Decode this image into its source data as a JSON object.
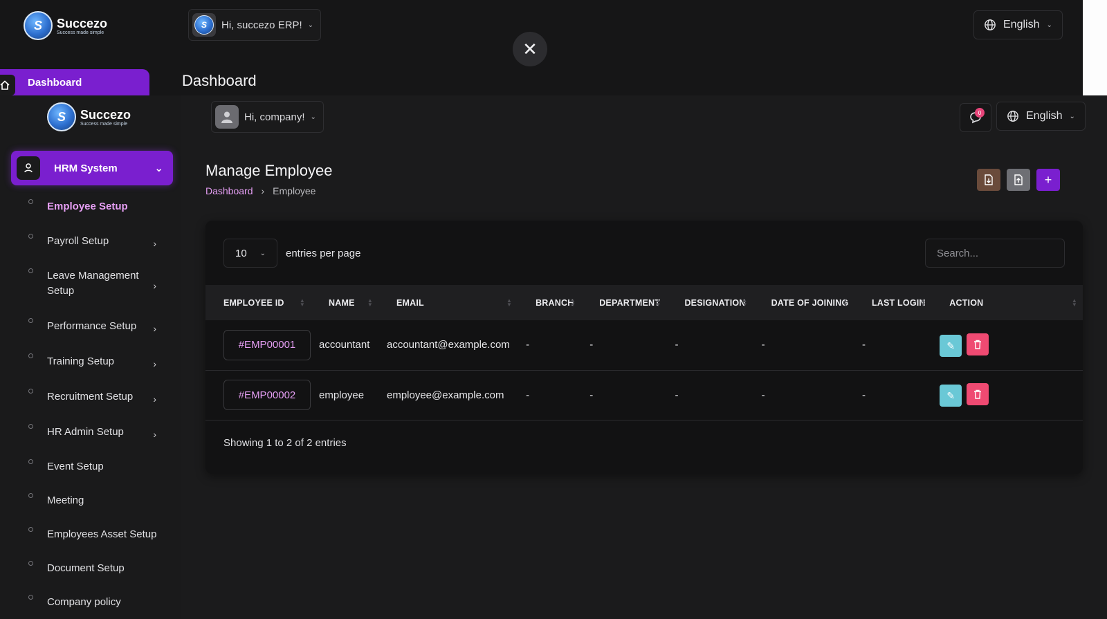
{
  "outer": {
    "brand": "Succezo",
    "tagline": "Success made simple",
    "user_greeting": "Hi, succezo ERP!",
    "language": "English",
    "dashboard_tab": "Dashboard",
    "page_heading": "Dashboard"
  },
  "sidebar": {
    "brand": "Succezo",
    "tagline": "Success made simple",
    "module": "HRM System",
    "items": [
      {
        "label": "Employee Setup",
        "active": true,
        "has_arrow": false
      },
      {
        "label": "Payroll Setup",
        "has_arrow": true
      },
      {
        "label": "Leave Management Setup",
        "has_arrow": true
      },
      {
        "label": "Performance Setup",
        "has_arrow": true
      },
      {
        "label": "Training Setup",
        "has_arrow": true
      },
      {
        "label": "Recruitment Setup",
        "has_arrow": true
      },
      {
        "label": "HR Admin Setup",
        "has_arrow": true
      },
      {
        "label": "Event Setup",
        "has_arrow": false
      },
      {
        "label": "Meeting",
        "has_arrow": false
      },
      {
        "label": "Employees Asset Setup",
        "has_arrow": false
      },
      {
        "label": "Document Setup",
        "has_arrow": false
      },
      {
        "label": "Company policy",
        "has_arrow": false
      }
    ]
  },
  "header": {
    "user_greeting": "Hi, company!",
    "notification_count": "0",
    "language": "English"
  },
  "page": {
    "title": "Manage Employee",
    "breadcrumb": [
      "Dashboard",
      "Employee"
    ]
  },
  "table": {
    "per_page": "10",
    "per_page_label": "entries per page",
    "search_placeholder": "Search...",
    "columns": [
      "EMPLOYEE ID",
      "NAME",
      "EMAIL",
      "BRANCH",
      "DEPARTMENT",
      "DESIGNATION",
      "DATE OF JOINING",
      "LAST LOGIN",
      "ACTION"
    ],
    "rows": [
      {
        "id": "#EMP00001",
        "name": "accountant",
        "email": "accountant@example.com",
        "branch": "-",
        "department": "-",
        "designation": "-",
        "date_of_joining": "-",
        "last_login": "-"
      },
      {
        "id": "#EMP00002",
        "name": "employee",
        "email": "employee@example.com",
        "branch": "-",
        "department": "-",
        "designation": "-",
        "date_of_joining": "-",
        "last_login": "-"
      }
    ],
    "footer": "Showing 1 to 2 of 2 entries"
  },
  "colors": {
    "accent": "#7a1fcf",
    "link": "#e59ef3",
    "edit": "#6ac8d6",
    "delete": "#ef4a72"
  }
}
